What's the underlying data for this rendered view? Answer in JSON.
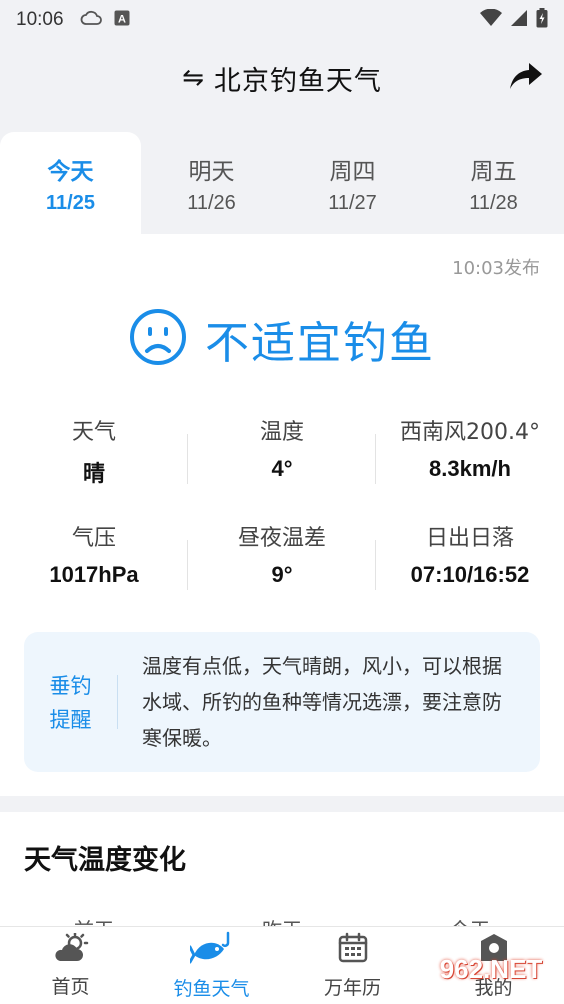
{
  "status_bar": {
    "time": "10:06"
  },
  "header": {
    "title": "北京钓鱼天气",
    "switch_glyph": "⇋"
  },
  "tabs": [
    {
      "label": "今天",
      "date": "11/25",
      "active": true
    },
    {
      "label": "明天",
      "date": "11/26",
      "active": false
    },
    {
      "label": "周四",
      "date": "11/27",
      "active": false
    },
    {
      "label": "周五",
      "date": "11/28",
      "active": false
    }
  ],
  "publish_time": "10:03发布",
  "verdict": {
    "text": "不适宜钓鱼",
    "icon": "sad-face-icon",
    "color": "#1a8de8"
  },
  "metrics": [
    {
      "label": "天气",
      "value": "晴"
    },
    {
      "label": "温度",
      "value": "4°"
    },
    {
      "label": "西南风200.4°",
      "value": "8.3km/h"
    },
    {
      "label": "气压",
      "value": "1017hPa"
    },
    {
      "label": "昼夜温差",
      "value": "9°"
    },
    {
      "label": "日出日落",
      "value": "07:10/16:52"
    }
  ],
  "tip": {
    "title_line1": "垂钓",
    "title_line2": "提醒",
    "text": "温度有点低，天气晴朗，风小，可以根据水域、所钓的鱼种等情况选漂，要注意防寒保暖。"
  },
  "temp_section": {
    "title": "天气温度变化",
    "cols": [
      "前天",
      "昨天",
      "今天"
    ]
  },
  "bottom_nav": [
    {
      "label": "首页",
      "icon": "weather-icon"
    },
    {
      "label": "钓鱼天气",
      "icon": "fish-icon",
      "active": true
    },
    {
      "label": "万年历",
      "icon": "calendar-icon"
    },
    {
      "label": "我的",
      "icon": "profile-icon"
    }
  ],
  "watermark": "962.NET"
}
